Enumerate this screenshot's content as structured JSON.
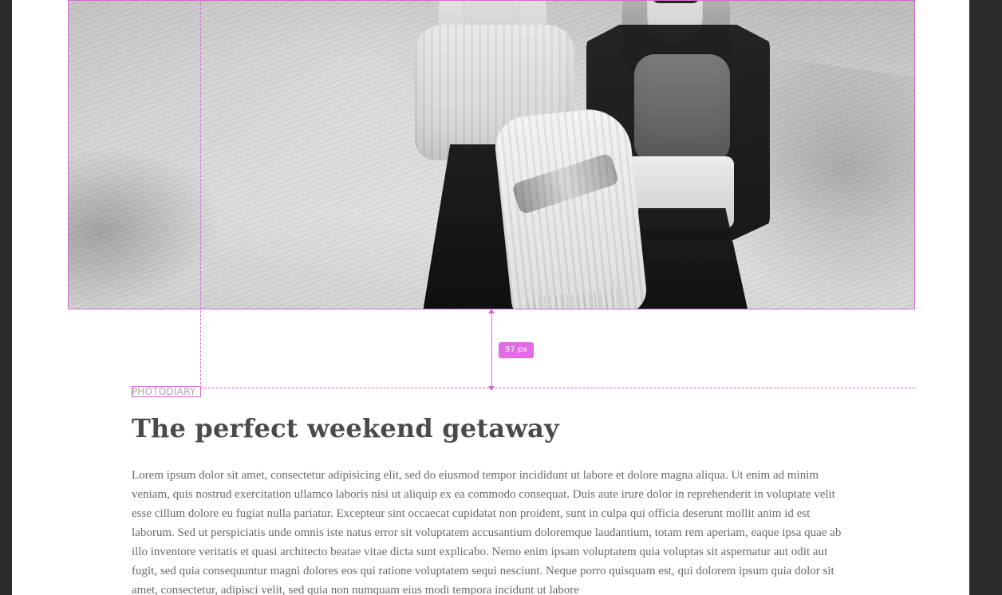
{
  "overlay": {
    "spacing_badge": "97 px"
  },
  "article": {
    "kicker": "PHOTODIARY",
    "title": "The perfect weekend getaway",
    "body": "Lorem ipsum dolor sit amet, consectetur adipisicing elit, sed do eiusmod tempor incididunt ut labore et dolore magna aliqua. Ut enim ad minim veniam, quis nostrud exercitation ullamco laboris nisi ut aliquip ex ea commodo consequat. Duis aute irure dolor in reprehenderit in voluptate velit esse cillum dolore eu fugiat nulla pariatur. Excepteur sint occaecat cupidatat non proident, sunt in culpa qui officia deserunt mollit anim id est laborum. Sed ut perspiciatis unde omnis iste natus error sit voluptatem accusantium doloremque laudantium, totam rem aperiam, eaque ipsa quae ab illo inventore veritatis et quasi architecto beatae vitae dicta sunt explicabo. Nemo enim ipsam voluptatem quia voluptas sit aspernatur aut odit aut fugit, sed quia consequuntur magni dolores eos qui ratione voluptatem sequi nesciunt. Neque porro quisquam est, qui dolorem ipsum quia dolor sit amet, consectetur, adipisci velit, sed quia non numquam eius modi tempora incidunt ut labore"
  },
  "colors": {
    "background_outer": "#2b2b2b",
    "canvas": "#ffffff",
    "guides": "#d36ad3",
    "badge": "#e36be3",
    "kicker_text": "#a6a6a6",
    "headline_text": "#4a4a4a",
    "body_text": "#6a6a6a"
  }
}
